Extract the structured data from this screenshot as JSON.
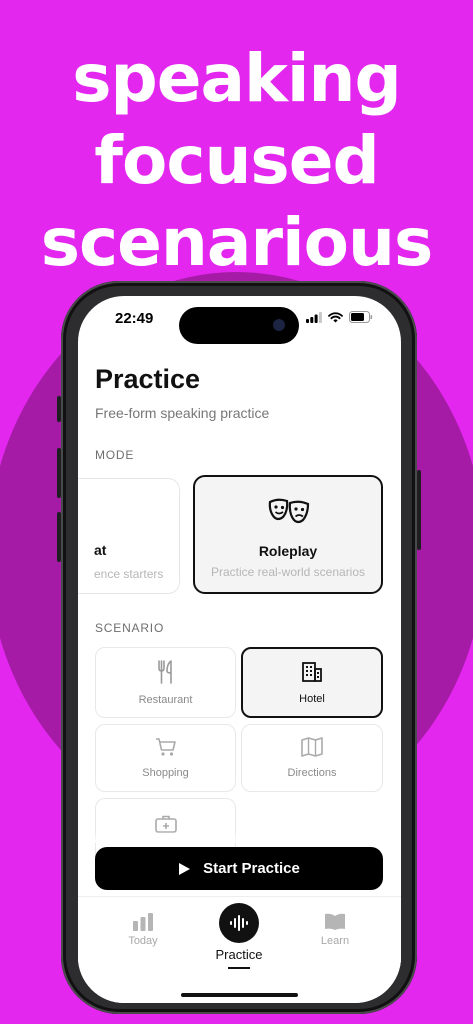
{
  "headline": [
    "speaking",
    "focused",
    "scenarious"
  ],
  "status_bar": {
    "time": "22:49"
  },
  "page": {
    "title": "Practice",
    "subtitle": "Free-form speaking practice"
  },
  "mode": {
    "label": "MODE",
    "cards": [
      {
        "name": "at",
        "desc": "ence starters",
        "selected": false
      },
      {
        "name": "Roleplay",
        "desc": "Practice real-world scenarios",
        "selected": true,
        "icon": "theater-masks-icon"
      }
    ]
  },
  "scenario": {
    "label": "SCENARIO",
    "items": [
      {
        "label": "Restaurant",
        "icon": "fork-knife-icon",
        "selected": false
      },
      {
        "label": "Hotel",
        "icon": "building-icon",
        "selected": true
      },
      {
        "label": "Shopping",
        "icon": "cart-icon",
        "selected": false
      },
      {
        "label": "Directions",
        "icon": "map-icon",
        "selected": false
      },
      {
        "label": "",
        "icon": "medical-kit-icon",
        "selected": false
      }
    ]
  },
  "start_button": {
    "label": "Start Practice",
    "icon": "play-icon"
  },
  "tabbar": {
    "items": [
      {
        "label": "Today",
        "icon": "bar-chart-icon",
        "active": false
      },
      {
        "label": "Practice",
        "icon": "waveform-icon",
        "active": true
      },
      {
        "label": "Learn",
        "icon": "book-icon",
        "active": false
      }
    ]
  },
  "colors": {
    "background": "#e327ef",
    "accent": "#000000"
  }
}
